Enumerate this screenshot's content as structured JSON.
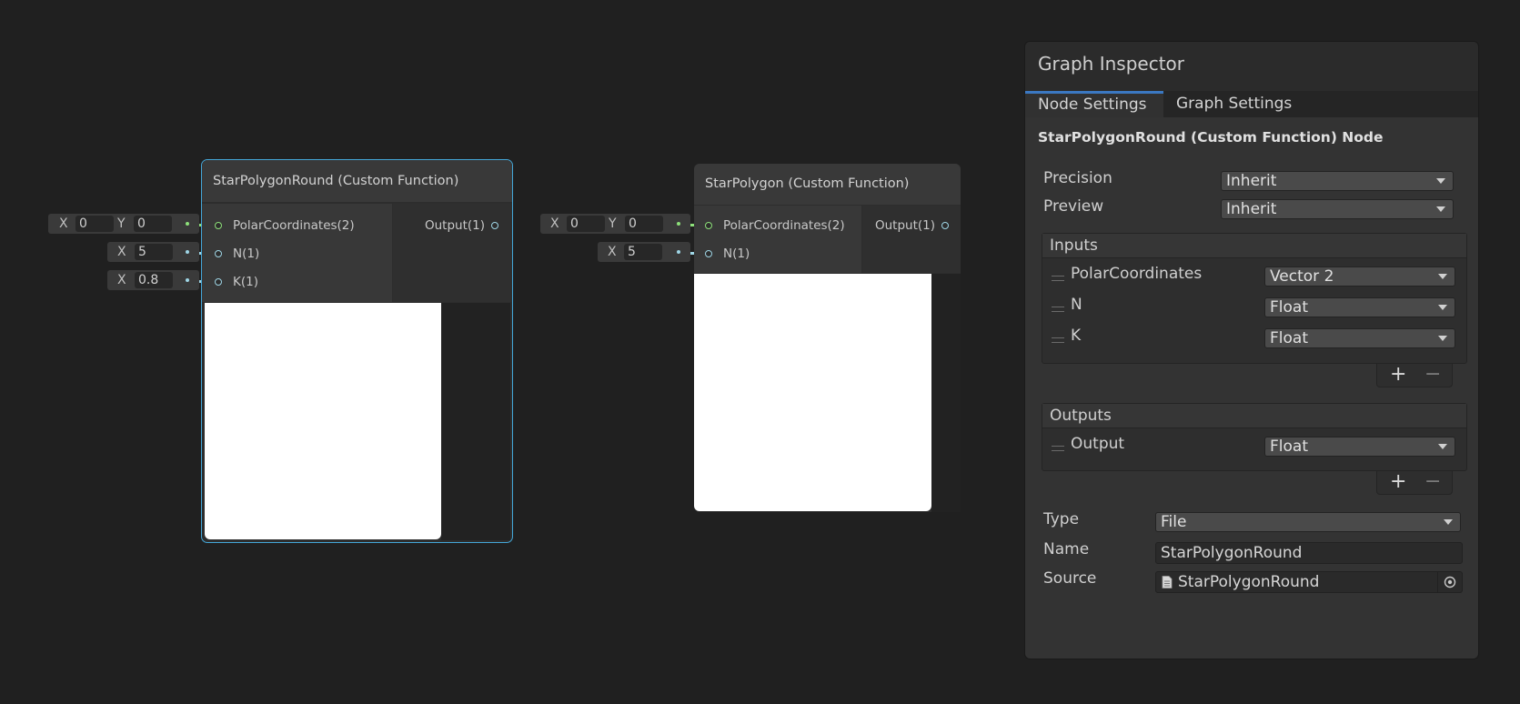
{
  "nodes": [
    {
      "title": "StarPolygonRound (Custom Function)",
      "inputs": [
        "PolarCoordinates(2)",
        "N(1)",
        "K(1)"
      ],
      "output": "Output(1)",
      "defaults": {
        "polar": {
          "x_label": "X",
          "x": "0",
          "y_label": "Y",
          "y": "0"
        },
        "n": {
          "x_label": "X",
          "x": "5"
        },
        "k": {
          "x_label": "X",
          "x": "0.8"
        }
      }
    },
    {
      "title": "StarPolygon (Custom Function)",
      "inputs": [
        "PolarCoordinates(2)",
        "N(1)"
      ],
      "output": "Output(1)",
      "defaults": {
        "polar": {
          "x_label": "X",
          "x": "0",
          "y_label": "Y",
          "y": "0"
        },
        "n": {
          "x_label": "X",
          "x": "5"
        }
      }
    }
  ],
  "inspector": {
    "title": "Graph Inspector",
    "tabs": [
      "Node Settings",
      "Graph Settings"
    ],
    "active_tab": "Node Settings",
    "heading": "StarPolygonRound (Custom Function) Node",
    "precision": {
      "label": "Precision",
      "value": "Inherit"
    },
    "preview": {
      "label": "Preview",
      "value": "Inherit"
    },
    "inputs": {
      "title": "Inputs",
      "rows": [
        {
          "name": "PolarCoordinates",
          "type": "Vector 2"
        },
        {
          "name": "N",
          "type": "Float"
        },
        {
          "name": "K",
          "type": "Float"
        }
      ]
    },
    "outputs": {
      "title": "Outputs",
      "rows": [
        {
          "name": "Output",
          "type": "Float"
        }
      ]
    },
    "plus": "+",
    "minus": "−",
    "type": {
      "label": "Type",
      "value": "File"
    },
    "name": {
      "label": "Name",
      "value": "StarPolygonRound"
    },
    "source": {
      "label": "Source",
      "value": "StarPolygonRound"
    }
  },
  "colors": {
    "accent_selection": "#44a7d8",
    "tab_indicator": "#3b78c2",
    "port_vector2": "#8de07a",
    "port_float": "#9fd6e6"
  }
}
